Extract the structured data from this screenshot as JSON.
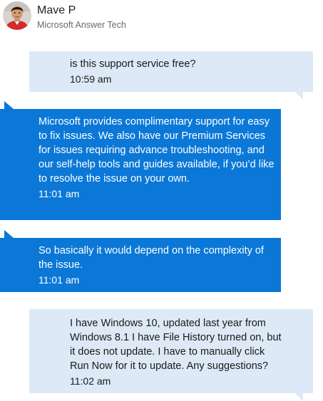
{
  "agent": {
    "name": "Mave P",
    "role": "Microsoft Answer Tech"
  },
  "messages": [
    {
      "sender": "user",
      "text": "is this support service free?",
      "time": "10:59 am"
    },
    {
      "sender": "agent",
      "text": "Microsoft provides complimentary support for easy to fix issues. We also have our Premium Services for issues requiring advance troubleshooting, and our self-help tools and guides available, if you’d like to resolve the issue on your own.",
      "time": "11:01 am"
    },
    {
      "sender": "agent",
      "text": "So basically it would depend on the complexity of the issue.",
      "time": "11:01 am"
    },
    {
      "sender": "user",
      "text": "I have Windows 10, updated last year from Windows 8.1 I have File History turned on, but it does not update. I have to manually click Run Now for it to update. Any suggestions?",
      "time": "11:02 am"
    }
  ],
  "colors": {
    "user_bubble": "#dde9f6",
    "agent_bubble": "#0b78d7"
  }
}
